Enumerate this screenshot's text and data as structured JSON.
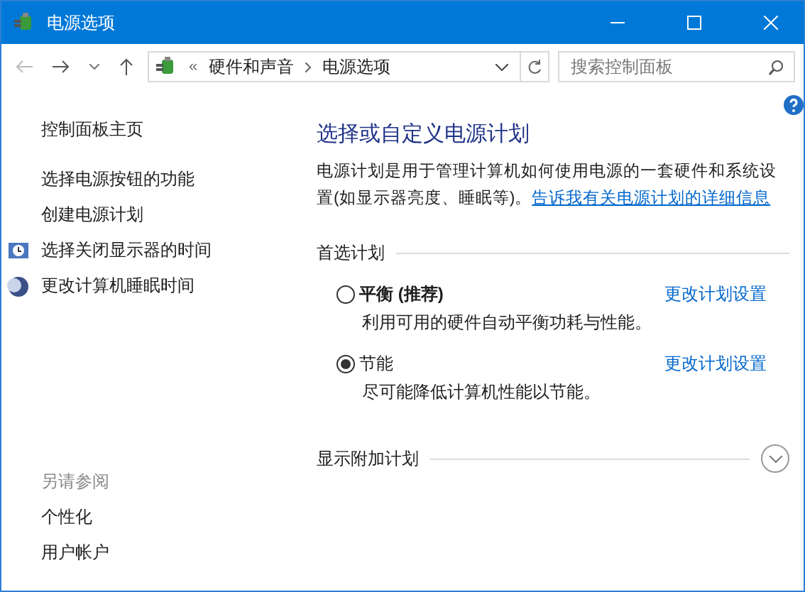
{
  "window": {
    "title": "电源选项"
  },
  "navigation": {
    "overflow": "«",
    "breadcrumbs": [
      "硬件和声音",
      "电源选项"
    ],
    "search": {
      "placeholder": "搜索控制面板"
    }
  },
  "sidebar": {
    "home": "控制面板主页",
    "tasks": [
      {
        "label": "选择电源按钮的功能",
        "kind": "plain"
      },
      {
        "label": "创建电源计划",
        "kind": "plain"
      },
      {
        "label": "选择关闭显示器的时间",
        "kind": "display"
      },
      {
        "label": "更改计算机睡眠时间",
        "kind": "sleep"
      }
    ],
    "see_also": {
      "heading": "另请参阅",
      "links": [
        "个性化",
        "用户帐户"
      ]
    }
  },
  "main": {
    "heading": "选择或自定义电源计划",
    "description": "电源计划是用于管理计算机如何使用电源的一套硬件和系统设置(如显示器亮度、睡眠等)。",
    "learn_more": "告诉我有关电源计划的详细信息",
    "section": "首选计划",
    "plans": [
      {
        "name": "平衡 (推荐)",
        "recommended": true,
        "selected": false,
        "description": "利用可用的硬件自动平衡功耗与性能。",
        "link": "更改计划设置"
      },
      {
        "name": "节能",
        "recommended": false,
        "selected": true,
        "description": "尽可能降低计算机性能以节能。",
        "link": "更改计划设置"
      }
    ],
    "more_plans": {
      "label": "显示附加计划",
      "expanded": false
    }
  }
}
